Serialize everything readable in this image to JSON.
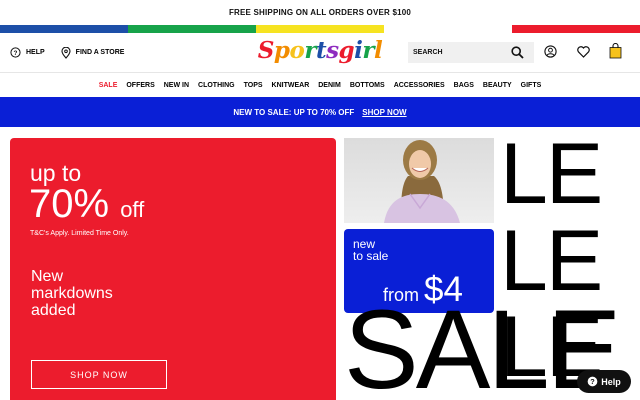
{
  "top_banner": {
    "text": "FREE SHIPPING ON ALL ORDERS OVER $100"
  },
  "stripe_colors": [
    "#1d4fa8",
    "#17a34a",
    "#f6e321",
    "#ffffff",
    "#ec1c2d"
  ],
  "header": {
    "help_label": "HELP",
    "find_store_label": "FIND A STORE",
    "logo_text": "Sportsgirl",
    "logo_colors": [
      "#ec1c2d",
      "#f28c00",
      "#f6c21c",
      "#17a34a",
      "#1d4fa8",
      "#8e2bbf",
      "#ec1c2d",
      "#1d4fa8",
      "#17a34a",
      "#f28c00"
    ],
    "search_placeholder": "SEARCH",
    "icons": [
      "account-icon",
      "wishlist-icon",
      "bag-icon"
    ]
  },
  "nav": {
    "items": [
      "SALE",
      "OFFERS",
      "NEW IN",
      "CLOTHING",
      "TOPS",
      "KNITWEAR",
      "DENIM",
      "BOTTOMS",
      "ACCESSORIES",
      "BAGS",
      "BEAUTY",
      "GIFTS"
    ],
    "sale_color": "#ec1c2d"
  },
  "promo": {
    "text": "NEW TO SALE: UP TO 70% OFF",
    "link": "SHOP NOW",
    "bg": "#0a1fd6"
  },
  "hero": {
    "upto": "up to",
    "percent": "70%",
    "off": "off",
    "tc": "T&C's Apply. Limited Time Only.",
    "markdowns": [
      "New",
      "markdowns",
      "added"
    ],
    "shop_now": "SHOP NOW",
    "bg": "#ec1c2d"
  },
  "new_to_sale": {
    "line1": "new",
    "line2": "to sale",
    "from": "from",
    "price": "$4",
    "bg": "#0a1fd6"
  },
  "sale_graphic": {
    "le_lines": [
      "LE",
      "LE",
      "LE"
    ],
    "sale_text": "SALE"
  },
  "help_button": {
    "label": "Help"
  }
}
